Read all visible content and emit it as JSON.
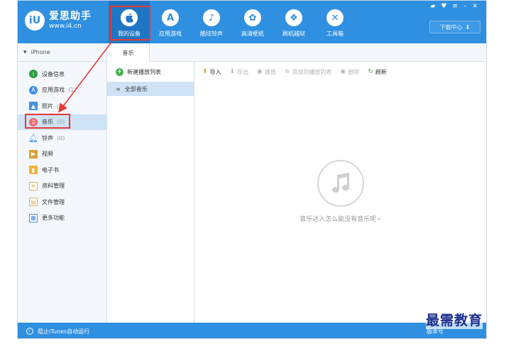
{
  "app": {
    "logo_mark": "iU",
    "name": "爱思助手",
    "url": "www.i4.cn",
    "window_controls": [
      "▰",
      "♥",
      "≡",
      "–",
      "✕"
    ]
  },
  "nav": [
    {
      "label": "我的设备",
      "icon": "apple-icon",
      "glyph": "",
      "active": true
    },
    {
      "label": "应用游戏",
      "icon": "app-store-icon",
      "glyph": "A",
      "active": false
    },
    {
      "label": "酷炫铃声",
      "icon": "bell-icon",
      "glyph": "♪",
      "active": false
    },
    {
      "label": "高清壁纸",
      "icon": "flower-icon",
      "glyph": "✿",
      "active": false
    },
    {
      "label": "刷机越狱",
      "icon": "box-icon",
      "glyph": "❖",
      "active": false
    },
    {
      "label": "工具箱",
      "icon": "tools-icon",
      "glyph": "✕",
      "active": false
    }
  ],
  "download_center": {
    "label": "下载中心",
    "icon": "download-icon"
  },
  "sidebar": {
    "device": "iPhone",
    "items": [
      {
        "label": "设备信息",
        "count": "",
        "icon": "info-icon",
        "color": "#2e9e3e"
      },
      {
        "label": "应用游戏",
        "count": "(1)",
        "icon": "app-store-icon",
        "color": "#3a8ee6"
      },
      {
        "label": "照片",
        "count": "(0)",
        "icon": "photo-icon",
        "color": "#4a90d9"
      },
      {
        "label": "音乐",
        "count": "(0)",
        "icon": "music-icon",
        "color": "#f06a6a"
      },
      {
        "label": "铃声",
        "count": "(0)",
        "icon": "bell-icon",
        "color": "#3a8ee6"
      },
      {
        "label": "视频",
        "count": "",
        "icon": "video-icon",
        "color": "#d9a23a"
      },
      {
        "label": "电子书",
        "count": "",
        "icon": "book-icon",
        "color": "#f0b43a"
      },
      {
        "label": "资料管理",
        "count": "",
        "icon": "contacts-icon",
        "color": "#d9b45a"
      },
      {
        "label": "文件管理",
        "count": "",
        "icon": "file-icon",
        "color": "#d9b45a"
      },
      {
        "label": "更多功能",
        "count": "",
        "icon": "grid-icon",
        "color": "#4a90d9"
      }
    ]
  },
  "tab": {
    "label": "音乐"
  },
  "playlists": {
    "new_label": "新建播放列表",
    "items": [
      {
        "label": "全部音乐"
      }
    ]
  },
  "toolbar": [
    {
      "label": "导入",
      "icon": "import-icon",
      "glyph": "⬆",
      "enabled": true
    },
    {
      "label": "导出",
      "icon": "export-icon",
      "glyph": "⬇",
      "enabled": false
    },
    {
      "label": "播放",
      "icon": "play-icon",
      "glyph": "◉",
      "enabled": false
    },
    {
      "label": "添加到播放列表",
      "icon": "add-to-playlist-icon",
      "glyph": "≡",
      "enabled": false
    },
    {
      "label": "删除",
      "icon": "delete-icon",
      "glyph": "◉",
      "enabled": false
    },
    {
      "label": "刷新",
      "icon": "refresh-icon",
      "glyph": "↻",
      "enabled": true
    }
  ],
  "empty_state": {
    "icon": "music-note-icon",
    "text": "音乐达人怎么能没有音乐呢~"
  },
  "bottom": {
    "itunes_label": "阻止iTunes自动运行",
    "version_label": "版本号"
  },
  "watermark": "最需教育",
  "colors": {
    "brand_blue": "#2f8fe0",
    "active_nav": "#1f76c4",
    "selection": "#cfe3f7",
    "annotation_red": "#e53935"
  }
}
